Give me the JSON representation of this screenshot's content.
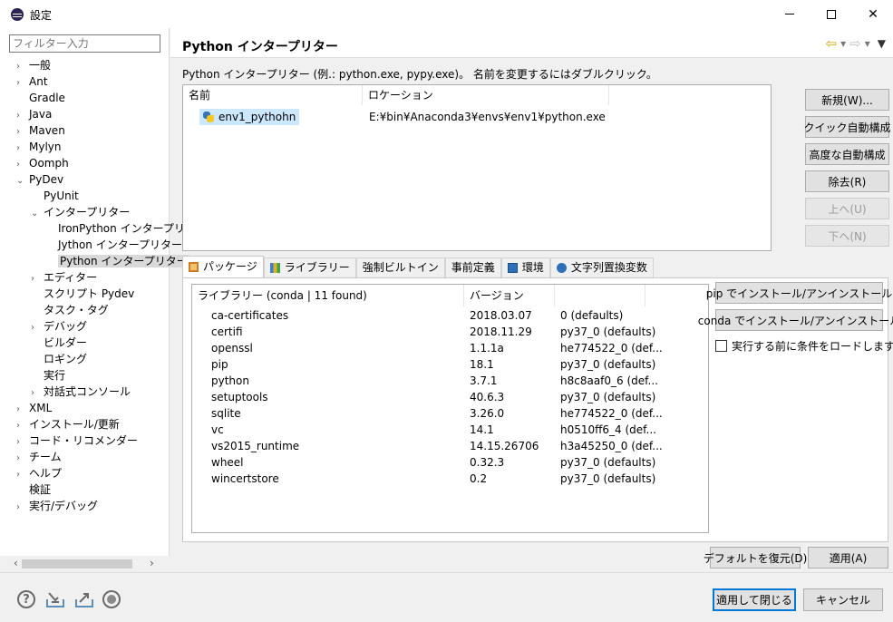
{
  "window": {
    "title": "設定"
  },
  "filter": {
    "placeholder": "フィルター入力"
  },
  "tree": [
    {
      "label": "一般",
      "indent": 0,
      "tw": "›"
    },
    {
      "label": "Ant",
      "indent": 0,
      "tw": "›"
    },
    {
      "label": "Gradle",
      "indent": 0,
      "tw": ""
    },
    {
      "label": "Java",
      "indent": 0,
      "tw": "›"
    },
    {
      "label": "Maven",
      "indent": 0,
      "tw": "›"
    },
    {
      "label": "Mylyn",
      "indent": 0,
      "tw": "›"
    },
    {
      "label": "Oomph",
      "indent": 0,
      "tw": "›"
    },
    {
      "label": "PyDev",
      "indent": 0,
      "tw": "⌄"
    },
    {
      "label": "PyUnit",
      "indent": 1,
      "tw": ""
    },
    {
      "label": "インタープリター",
      "indent": 1,
      "tw": "⌄"
    },
    {
      "label": "IronPython インタープリ",
      "indent": 2,
      "tw": ""
    },
    {
      "label": "Jython インタープリター",
      "indent": 2,
      "tw": ""
    },
    {
      "label": "Python インタープリター",
      "indent": 2,
      "tw": "",
      "selected": true
    },
    {
      "label": "エディター",
      "indent": 1,
      "tw": "›"
    },
    {
      "label": "スクリプト Pydev",
      "indent": 1,
      "tw": ""
    },
    {
      "label": "タスク・タグ",
      "indent": 1,
      "tw": ""
    },
    {
      "label": "デバッグ",
      "indent": 1,
      "tw": "›"
    },
    {
      "label": "ビルダー",
      "indent": 1,
      "tw": ""
    },
    {
      "label": "ロギング",
      "indent": 1,
      "tw": ""
    },
    {
      "label": "実行",
      "indent": 1,
      "tw": ""
    },
    {
      "label": "対話式コンソール",
      "indent": 1,
      "tw": "›"
    },
    {
      "label": "XML",
      "indent": 0,
      "tw": "›"
    },
    {
      "label": "インストール/更新",
      "indent": 0,
      "tw": "›"
    },
    {
      "label": "コード・リコメンダー",
      "indent": 0,
      "tw": "›"
    },
    {
      "label": "チーム",
      "indent": 0,
      "tw": "›"
    },
    {
      "label": "ヘルプ",
      "indent": 0,
      "tw": "›"
    },
    {
      "label": "検証",
      "indent": 0,
      "tw": ""
    },
    {
      "label": "実行/デバッグ",
      "indent": 0,
      "tw": "›"
    }
  ],
  "page": {
    "title": "Python インタープリター",
    "description": "Python インタープリター (例.: python.exe, pypy.exe)。 名前を変更するにはダブルクリック。"
  },
  "interpreters": {
    "columns": [
      "名前",
      "ロケーション"
    ],
    "rows": [
      {
        "name": "env1_pythohn",
        "location": "E:¥bin¥Anaconda3¥envs¥env1¥python.exe"
      }
    ]
  },
  "side_buttons": {
    "new": "新規(W)...",
    "quick": "クイック自動構成",
    "advanced": "高度な自動構成",
    "remove": "除去(R)",
    "up": "上へ(U)",
    "down": "下へ(N)"
  },
  "tabs": [
    "パッケージ",
    "ライブラリー",
    "強制ビルトイン",
    "事前定義",
    "環境",
    "文字列置換変数"
  ],
  "packages": {
    "columns": [
      "ライブラリー (conda | 11 found)",
      "バージョン",
      ""
    ],
    "rows": [
      [
        "ca-certificates",
        "2018.03.07",
        "0 (defaults)"
      ],
      [
        "certifi",
        "2018.11.29",
        "py37_0 (defaults)"
      ],
      [
        "openssl",
        "1.1.1a",
        "he774522_0 (def..."
      ],
      [
        "pip",
        "18.1",
        "py37_0 (defaults)"
      ],
      [
        "python",
        "3.7.1",
        "h8c8aaf0_6 (def..."
      ],
      [
        "setuptools",
        "40.6.3",
        "py37_0 (defaults)"
      ],
      [
        "sqlite",
        "3.26.0",
        "he774522_0 (def..."
      ],
      [
        "vc",
        "14.1",
        "h0510ff6_4 (def..."
      ],
      [
        "vs2015_runtime",
        "14.15.26706",
        "h3a45250_0 (def..."
      ],
      [
        "wheel",
        "0.32.3",
        "py37_0 (defaults)"
      ],
      [
        "wincertstore",
        "0.2",
        "py37_0 (defaults)"
      ]
    ],
    "pip_button": "pip でインストール/アンインストール",
    "conda_button": "conda でインストール/アンインストール",
    "checkbox_label": "実行する前に条件をロードしますか?"
  },
  "footer": {
    "restore": "デフォルトを復元(D)",
    "apply": "適用(A)",
    "apply_close": "適用して閉じる",
    "cancel": "キャンセル"
  }
}
